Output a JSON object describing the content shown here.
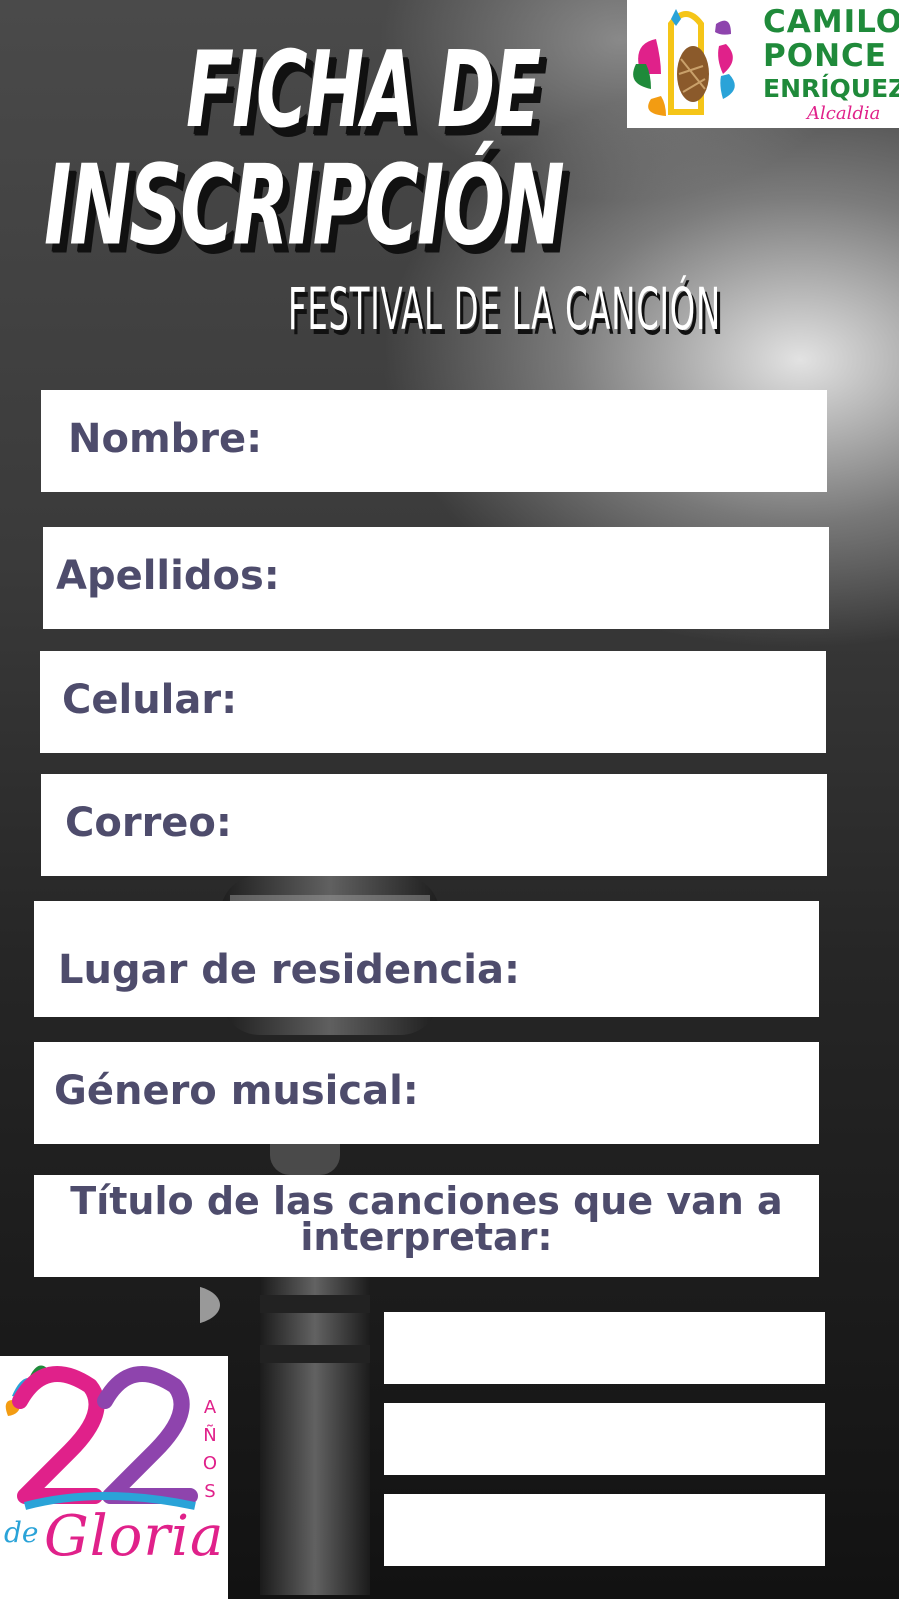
{
  "header": {
    "title_line1": "FICHA DE",
    "title_line2": "INSCRIPCIÓN",
    "subtitle": "FESTIVAL DE LA CANCIÓN"
  },
  "logo_top": {
    "line1": "CAMILO",
    "line2": "PONCE",
    "line3": "ENRÍQUEZ",
    "tagline": "Alcaldia",
    "colors": {
      "green": "#1f8a3a",
      "magenta": "#e0218a",
      "yellow": "#f5c518"
    }
  },
  "form": {
    "fields": [
      {
        "label": "Nombre:"
      },
      {
        "label": "Apellidos:"
      },
      {
        "label": "Celular:"
      },
      {
        "label": "Correo:"
      },
      {
        "label": "Lugar de residencia:"
      },
      {
        "label": "Género musical:"
      },
      {
        "label": "Título de las canciones que van a interpretar:"
      }
    ],
    "label_color": "#4e4c6c"
  },
  "logo_bottom": {
    "number": "22",
    "vertical": "AÑOS",
    "prefix": "de",
    "word": "Gloria"
  }
}
